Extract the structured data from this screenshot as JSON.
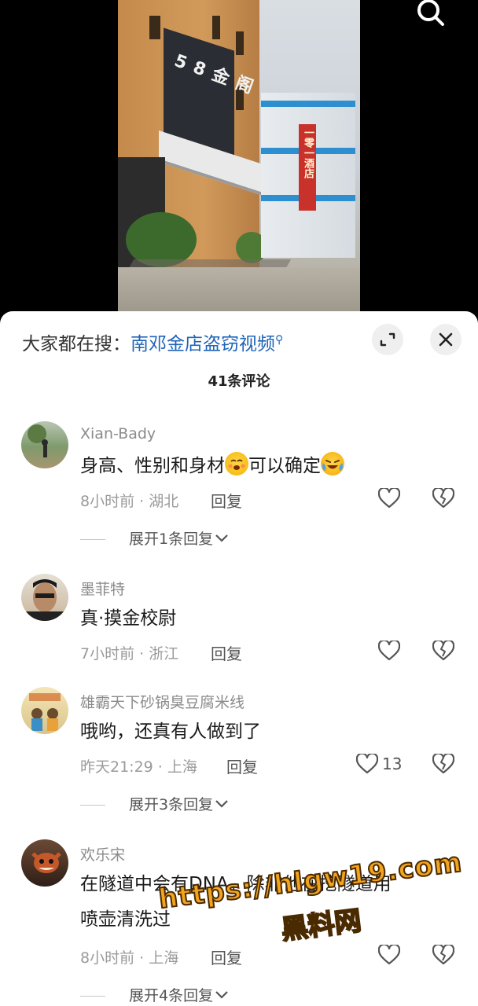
{
  "hot_search": {
    "prefix": "大家都在搜：",
    "keyword": "南邓金店盗窃视频"
  },
  "comment_count": "41条评论",
  "video": {
    "sign_text": "58金阁",
    "red_sign": "一零一酒店"
  },
  "comments": [
    {
      "username": "Xian-Bady",
      "text_before": "身高、性别和身材",
      "text_mid": "可以确定",
      "time": "8小时前",
      "location": "湖北",
      "reply_label": "回复",
      "likes": "",
      "expand": "展开1条回复"
    },
    {
      "username": "墨菲特",
      "text": "真·摸金校尉",
      "time": "7小时前",
      "location": "浙江",
      "reply_label": "回复",
      "likes": ""
    },
    {
      "username": "雄霸天下砂锅臭豆腐米线",
      "text": "哦哟，还真有人做到了",
      "time": "昨天21:29",
      "location": "上海",
      "reply_label": "回复",
      "likes": "13",
      "expand": "展开3条回复"
    },
    {
      "username": "欢乐宋",
      "text_line1": "在隧道中会有DNA，除非他在挖隧道用",
      "text_line2": "喷壶清洗过",
      "time": "8小时前",
      "location": "上海",
      "reply_label": "回复",
      "likes": "",
      "expand": "展开4条回复"
    }
  ],
  "watermark": {
    "url": "https://hlgw19.com",
    "cn": "黑料网"
  },
  "colors": {
    "link": "#1f64b8",
    "watermark": "#f2a41e",
    "meta": "#9a9a9a"
  }
}
